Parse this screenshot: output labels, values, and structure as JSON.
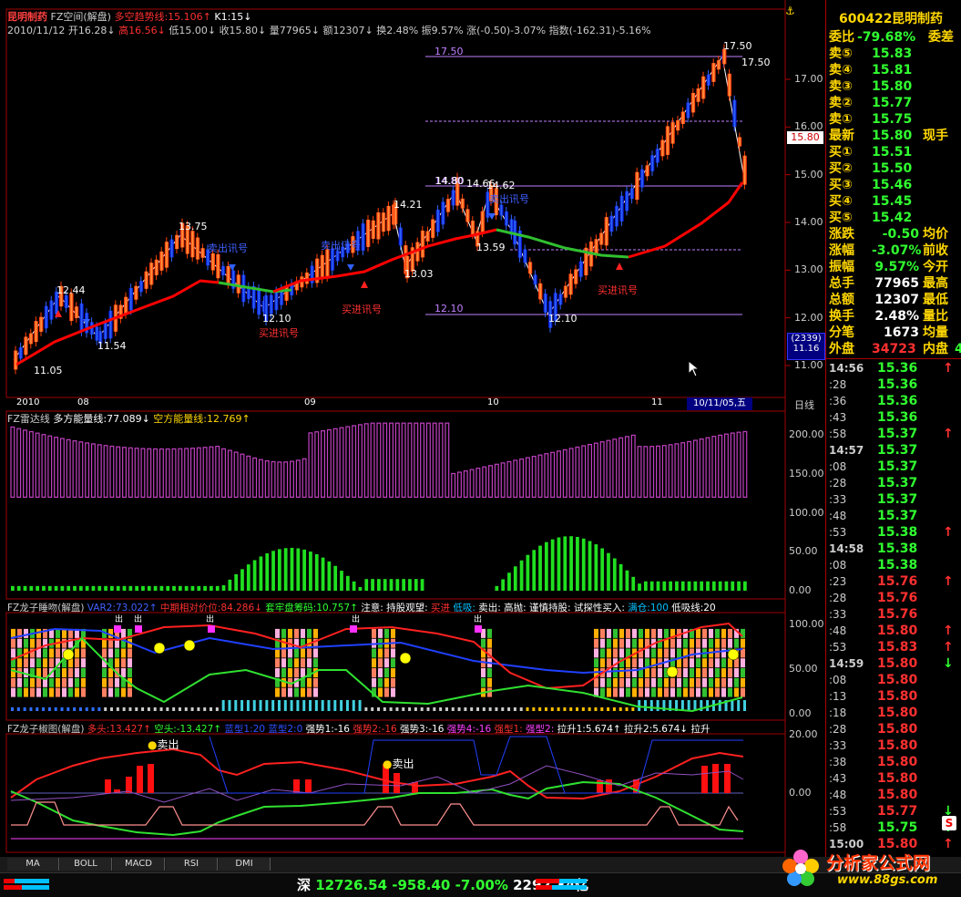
{
  "main_header": {
    "stock_name": "昆明制药",
    "line1_rest": "FZ空间(解盘)",
    "line1_indicator": "多空趋势线:15.106↑",
    "line1_k": "K1:15↓",
    "date": "2010/11/12",
    "open": "开16.28↓",
    "high": "高16.56↓",
    "low": "低15.00↓",
    "close": "收15.80↓",
    "volume": "量77965↓",
    "amount": "额12307↓",
    "turnover": "换2.48%",
    "amplitude": "振9.57%",
    "change": "涨(-0.50)-3.07%",
    "index_change": "指数(-162.31)-5.16%"
  },
  "main_chart": {
    "price_axis": [
      "17.00",
      "16.00",
      "15.00",
      "14.00",
      "13.00",
      "12.00",
      "11.00"
    ],
    "current_price_tag": "15.80",
    "vol_box_top": "(2339)",
    "vol_box_bottom": "11.16",
    "line_labels": {
      "top": "17.50",
      "mid": "14.80",
      "low": "12.10"
    },
    "peak_labels": [
      {
        "text": "12.44"
      },
      {
        "text": "11.54"
      },
      {
        "text": "13.75"
      },
      {
        "text": "12.10"
      },
      {
        "text": "13.03"
      },
      {
        "text": "14.21"
      },
      {
        "text": "14.80"
      },
      {
        "text": "14.66"
      },
      {
        "text": "14.62"
      },
      {
        "text": "13.59"
      },
      {
        "text": "12.10"
      },
      {
        "text": "17.50"
      },
      {
        "text": "17.50"
      },
      {
        "text": "11.05"
      }
    ],
    "signals": {
      "sell": "卖出讯号",
      "buy": "买进讯号"
    },
    "date_axis": [
      "2010",
      "08",
      "09",
      "10",
      "11"
    ],
    "cursor_date": "10/11/05,五",
    "period": "日线"
  },
  "panel2": {
    "title": "FZ雷达线",
    "multi": "多方能量线:77.089↓",
    "empty": "空方能量线:12.769↑",
    "axis": [
      "200.00",
      "150.00",
      "100.00",
      "50.00",
      "0.00"
    ]
  },
  "panel3": {
    "title": "FZ龙子睡吻(解盘)",
    "var": "VAR2:73.022↑",
    "mid": "中期相对价位:84.286↓",
    "chip": "套牢盘筹码:10.757↑",
    "note_a": "注意:",
    "note_b": "持股观望:",
    "note_c": "买进",
    "note_d": "低吸:",
    "note_e": "卖出:",
    "note_f": "高抛:",
    "note_g": "谨慎持股:",
    "note_h": "试探性买入:",
    "note_i": "满仓:100",
    "note_j": "低吸线:20",
    "mark": "出",
    "axis": [
      "100.00",
      "50.00",
      "0.00"
    ]
  },
  "panel4": {
    "title": "FZ龙子椒图(解盘)",
    "long": "多头:13.427↑",
    "short": "空头:-13.427↑",
    "b1": "蓝型1:20",
    "b2": "蓝型2:0",
    "s1": "强势1:-16",
    "s2": "强势2:-16",
    "s3": "强势3:-16",
    "s4": "强势4:-16",
    "r1": "强型1:",
    "r2": "强型2:",
    "lift1": "拉升1:5.674↑",
    "lift2": "拉升2:5.674↓",
    "lift3": "拉升",
    "sell_label": "卖出",
    "axis": [
      "20.00",
      "0.00"
    ]
  },
  "tabs": [
    "MA",
    "BOLL",
    "MACD",
    "RSI",
    "DMI"
  ],
  "status": {
    "market": "深",
    "index": "12726.54",
    "change": "-958.40",
    "pct": "-7.00%",
    "amount": "2292.34亿"
  },
  "watermark": {
    "text": "分析家公式网",
    "url": "www.88gs.com"
  },
  "quote": {
    "code": "600422",
    "name": "昆明制药",
    "weibi_label": "委比",
    "weibi": "-79.68%",
    "weicha_label": "委差",
    "sells": [
      {
        "label": "卖⑤",
        "price": "15.83"
      },
      {
        "label": "卖④",
        "price": "15.81"
      },
      {
        "label": "卖③",
        "price": "15.80"
      },
      {
        "label": "卖②",
        "price": "15.77"
      },
      {
        "label": "卖①",
        "price": "15.75"
      }
    ],
    "latest_label": "最新",
    "latest": "15.80",
    "now_hand": "现手",
    "buys": [
      {
        "label": "买①",
        "price": "15.51"
      },
      {
        "label": "买②",
        "price": "15.50"
      },
      {
        "label": "买③",
        "price": "15.46"
      },
      {
        "label": "买④",
        "price": "15.45"
      },
      {
        "label": "买⑤",
        "price": "15.42"
      }
    ],
    "stats": [
      {
        "label": "涨跌",
        "value": "-0.50",
        "label2": "均价"
      },
      {
        "label": "涨幅",
        "value": "-3.07%",
        "label2": "前收"
      },
      {
        "label": "振幅",
        "value": "9.57%",
        "label2": "今开"
      },
      {
        "label": "总手",
        "value": "77965",
        "label2": "最高"
      },
      {
        "label": "总额",
        "value": "12307",
        "label2": "最低"
      },
      {
        "label": "换手",
        "value": "2.48%",
        "label2": "量比"
      },
      {
        "label": "分笔",
        "value": "1673",
        "label2": "均量"
      }
    ],
    "outer_label": "外盘",
    "outer": "34723",
    "inner_label": "内盘",
    "inner_val": "4"
  },
  "ticks": [
    {
      "time": "14:56",
      "price": "15.36",
      "dir": "↑"
    },
    {
      "time": ":28",
      "price": "15.36",
      "dir": ""
    },
    {
      "time": ":36",
      "price": "15.36",
      "dir": ""
    },
    {
      "time": ":43",
      "price": "15.36",
      "dir": ""
    },
    {
      "time": ":58",
      "price": "15.37",
      "dir": "↑"
    },
    {
      "time": "14:57",
      "price": "15.37",
      "dir": ""
    },
    {
      "time": ":08",
      "price": "15.37",
      "dir": ""
    },
    {
      "time": ":28",
      "price": "15.37",
      "dir": ""
    },
    {
      "time": ":33",
      "price": "15.37",
      "dir": ""
    },
    {
      "time": ":48",
      "price": "15.37",
      "dir": ""
    },
    {
      "time": ":53",
      "price": "15.38",
      "dir": "↑"
    },
    {
      "time": "14:58",
      "price": "15.38",
      "dir": ""
    },
    {
      "time": ":08",
      "price": "15.38",
      "dir": ""
    },
    {
      "time": ":23",
      "price": "15.76",
      "dir": "↑"
    },
    {
      "time": ":28",
      "price": "15.76",
      "dir": ""
    },
    {
      "time": ":33",
      "price": "15.76",
      "dir": ""
    },
    {
      "time": ":48",
      "price": "15.80",
      "dir": "↑"
    },
    {
      "time": ":53",
      "price": "15.83",
      "dir": "↑"
    },
    {
      "time": "14:59",
      "price": "15.80",
      "dir": "↓"
    },
    {
      "time": ":08",
      "price": "15.80",
      "dir": ""
    },
    {
      "time": ":13",
      "price": "15.80",
      "dir": ""
    },
    {
      "time": ":18",
      "price": "15.80",
      "dir": ""
    },
    {
      "time": ":28",
      "price": "15.80",
      "dir": ""
    },
    {
      "time": ":33",
      "price": "15.80",
      "dir": ""
    },
    {
      "time": ":38",
      "price": "15.80",
      "dir": ""
    },
    {
      "time": ":43",
      "price": "15.80",
      "dir": ""
    },
    {
      "time": ":48",
      "price": "15.80",
      "dir": ""
    },
    {
      "time": ":53",
      "price": "15.77",
      "dir": "↓"
    },
    {
      "time": ":58",
      "price": "15.75",
      "dir": "↓"
    },
    {
      "time": "15:00",
      "price": "15.80",
      "dir": "↑"
    }
  ],
  "colors": {
    "up": "#ff3030",
    "down": "#00c0ff",
    "label": "#ffd700",
    "grid": "#a00000"
  }
}
